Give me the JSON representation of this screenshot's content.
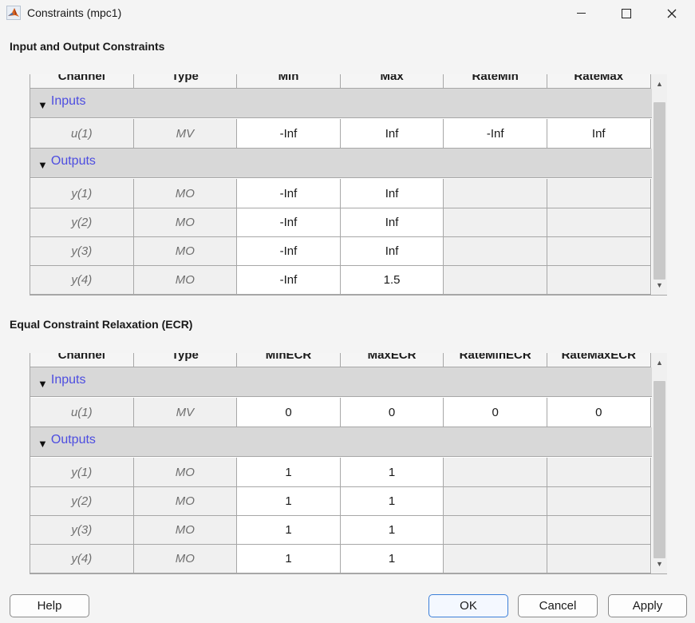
{
  "window": {
    "title": "Constraints (mpc1)",
    "icon": "matlab-icon"
  },
  "sections": {
    "io_title": "Input and Output Constraints",
    "ecr_title": "Equal Constraint Relaxation (ECR)"
  },
  "io_table": {
    "columns": [
      "Channel",
      "Type",
      "Min",
      "Max",
      "RateMin",
      "RateMax"
    ],
    "inputs_label": "Inputs",
    "outputs_label": "Outputs",
    "inputs": [
      {
        "channel": "u(1)",
        "type": "MV",
        "min": "-Inf",
        "max": "Inf",
        "ratemin": "-Inf",
        "ratemax": "Inf"
      }
    ],
    "outputs": [
      {
        "channel": "y(1)",
        "type": "MO",
        "min": "-Inf",
        "max": "Inf"
      },
      {
        "channel": "y(2)",
        "type": "MO",
        "min": "-Inf",
        "max": "Inf"
      },
      {
        "channel": "y(3)",
        "type": "MO",
        "min": "-Inf",
        "max": "Inf"
      },
      {
        "channel": "y(4)",
        "type": "MO",
        "min": "-Inf",
        "max": "1.5"
      }
    ]
  },
  "ecr_table": {
    "columns": [
      "Channel",
      "Type",
      "MinECR",
      "MaxECR",
      "RateMinECR",
      "RateMaxECR"
    ],
    "inputs_label": "Inputs",
    "outputs_label": "Outputs",
    "inputs": [
      {
        "channel": "u(1)",
        "type": "MV",
        "min": "0",
        "max": "0",
        "ratemin": "0",
        "ratemax": "0"
      }
    ],
    "outputs": [
      {
        "channel": "y(1)",
        "type": "MO",
        "min": "1",
        "max": "1"
      },
      {
        "channel": "y(2)",
        "type": "MO",
        "min": "1",
        "max": "1"
      },
      {
        "channel": "y(3)",
        "type": "MO",
        "min": "1",
        "max": "1"
      },
      {
        "channel": "y(4)",
        "type": "MO",
        "min": "1",
        "max": "1"
      }
    ]
  },
  "buttons": {
    "help": "Help",
    "ok": "OK",
    "cancel": "Cancel",
    "apply": "Apply"
  },
  "colors": {
    "group_label": "#4d4de0",
    "group_bg": "#d8d8d8",
    "primary_border": "#3c7fd8"
  }
}
